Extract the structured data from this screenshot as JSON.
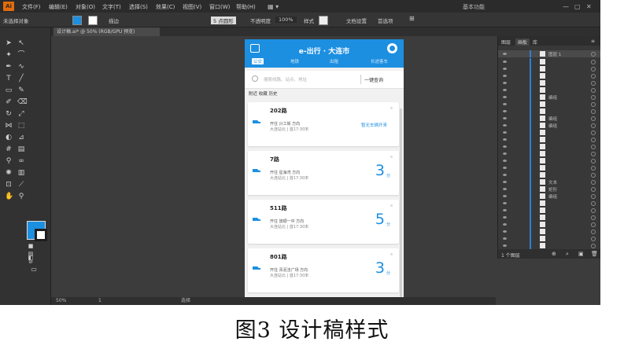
{
  "menubar": {
    "logo": "Ai",
    "items": [
      "文件(F)",
      "编辑(E)",
      "对象(O)",
      "文字(T)",
      "选择(S)",
      "效果(C)",
      "视图(V)",
      "窗口(W)",
      "帮助(H)"
    ],
    "workspace": "基本功能"
  },
  "optbar": {
    "label": "未选择对象",
    "fill_color": "#1c8fe1",
    "stroke_color": "#ffffff",
    "stroke_label": "描边",
    "brush": "5 点圆形",
    "opacity_label": "不透明度",
    "opacity": "100%",
    "style_label": "样式",
    "doc_setup": "文档设置",
    "prefs": "首选项"
  },
  "doc": {
    "tab": "设计稿.ai* @ 50% (RGB/GPU 预览)"
  },
  "phone": {
    "title": "e-出行 · 大连市",
    "tabs": [
      "公交",
      "地铁",
      "出租",
      "长途客车"
    ],
    "search_placeholder": "搜索线路、站点、地址",
    "search_btn": "一键查询",
    "filters": "附近 收藏 历史",
    "accent": "#1c8fe1",
    "cards": [
      {
        "route": "202路",
        "line1": "开往 兴工街 方向",
        "line2": "大连站北 | 首17:30末",
        "status": "暂无车辆开来",
        "eta": "",
        "unit": ""
      },
      {
        "route": "7路",
        "line1": "开往 星海湾 方向",
        "line2": "大连站北 | 首17:30末",
        "status": "",
        "eta": "3",
        "unit": "分"
      },
      {
        "route": "511路",
        "line1": "开往 旅顺一中 方向",
        "line2": "大连站北 | 首17:30末",
        "status": "",
        "eta": "5",
        "unit": "分"
      },
      {
        "route": "801路",
        "line1": "开往 青泥洼广场 方向",
        "line2": "大连站北 | 首17:30末",
        "status": "",
        "eta": "3",
        "unit": "分"
      }
    ]
  },
  "panel": {
    "tabs": [
      "图层",
      "画板",
      "库"
    ],
    "layer_top": "图层 1",
    "names": [
      "",
      "",
      "",
      "",
      "",
      "编组",
      "",
      "",
      "编组",
      "编组",
      "",
      "",
      "",
      "",
      "",
      "",
      "",
      "文本",
      "矩形",
      "编组",
      "",
      "",
      "",
      "",
      "",
      "",
      ""
    ],
    "footer": "1 个图层"
  },
  "statusbar": {
    "zoom": "50%",
    "page": "1",
    "tool": "选择"
  },
  "caption": "图3  设计稿样式"
}
